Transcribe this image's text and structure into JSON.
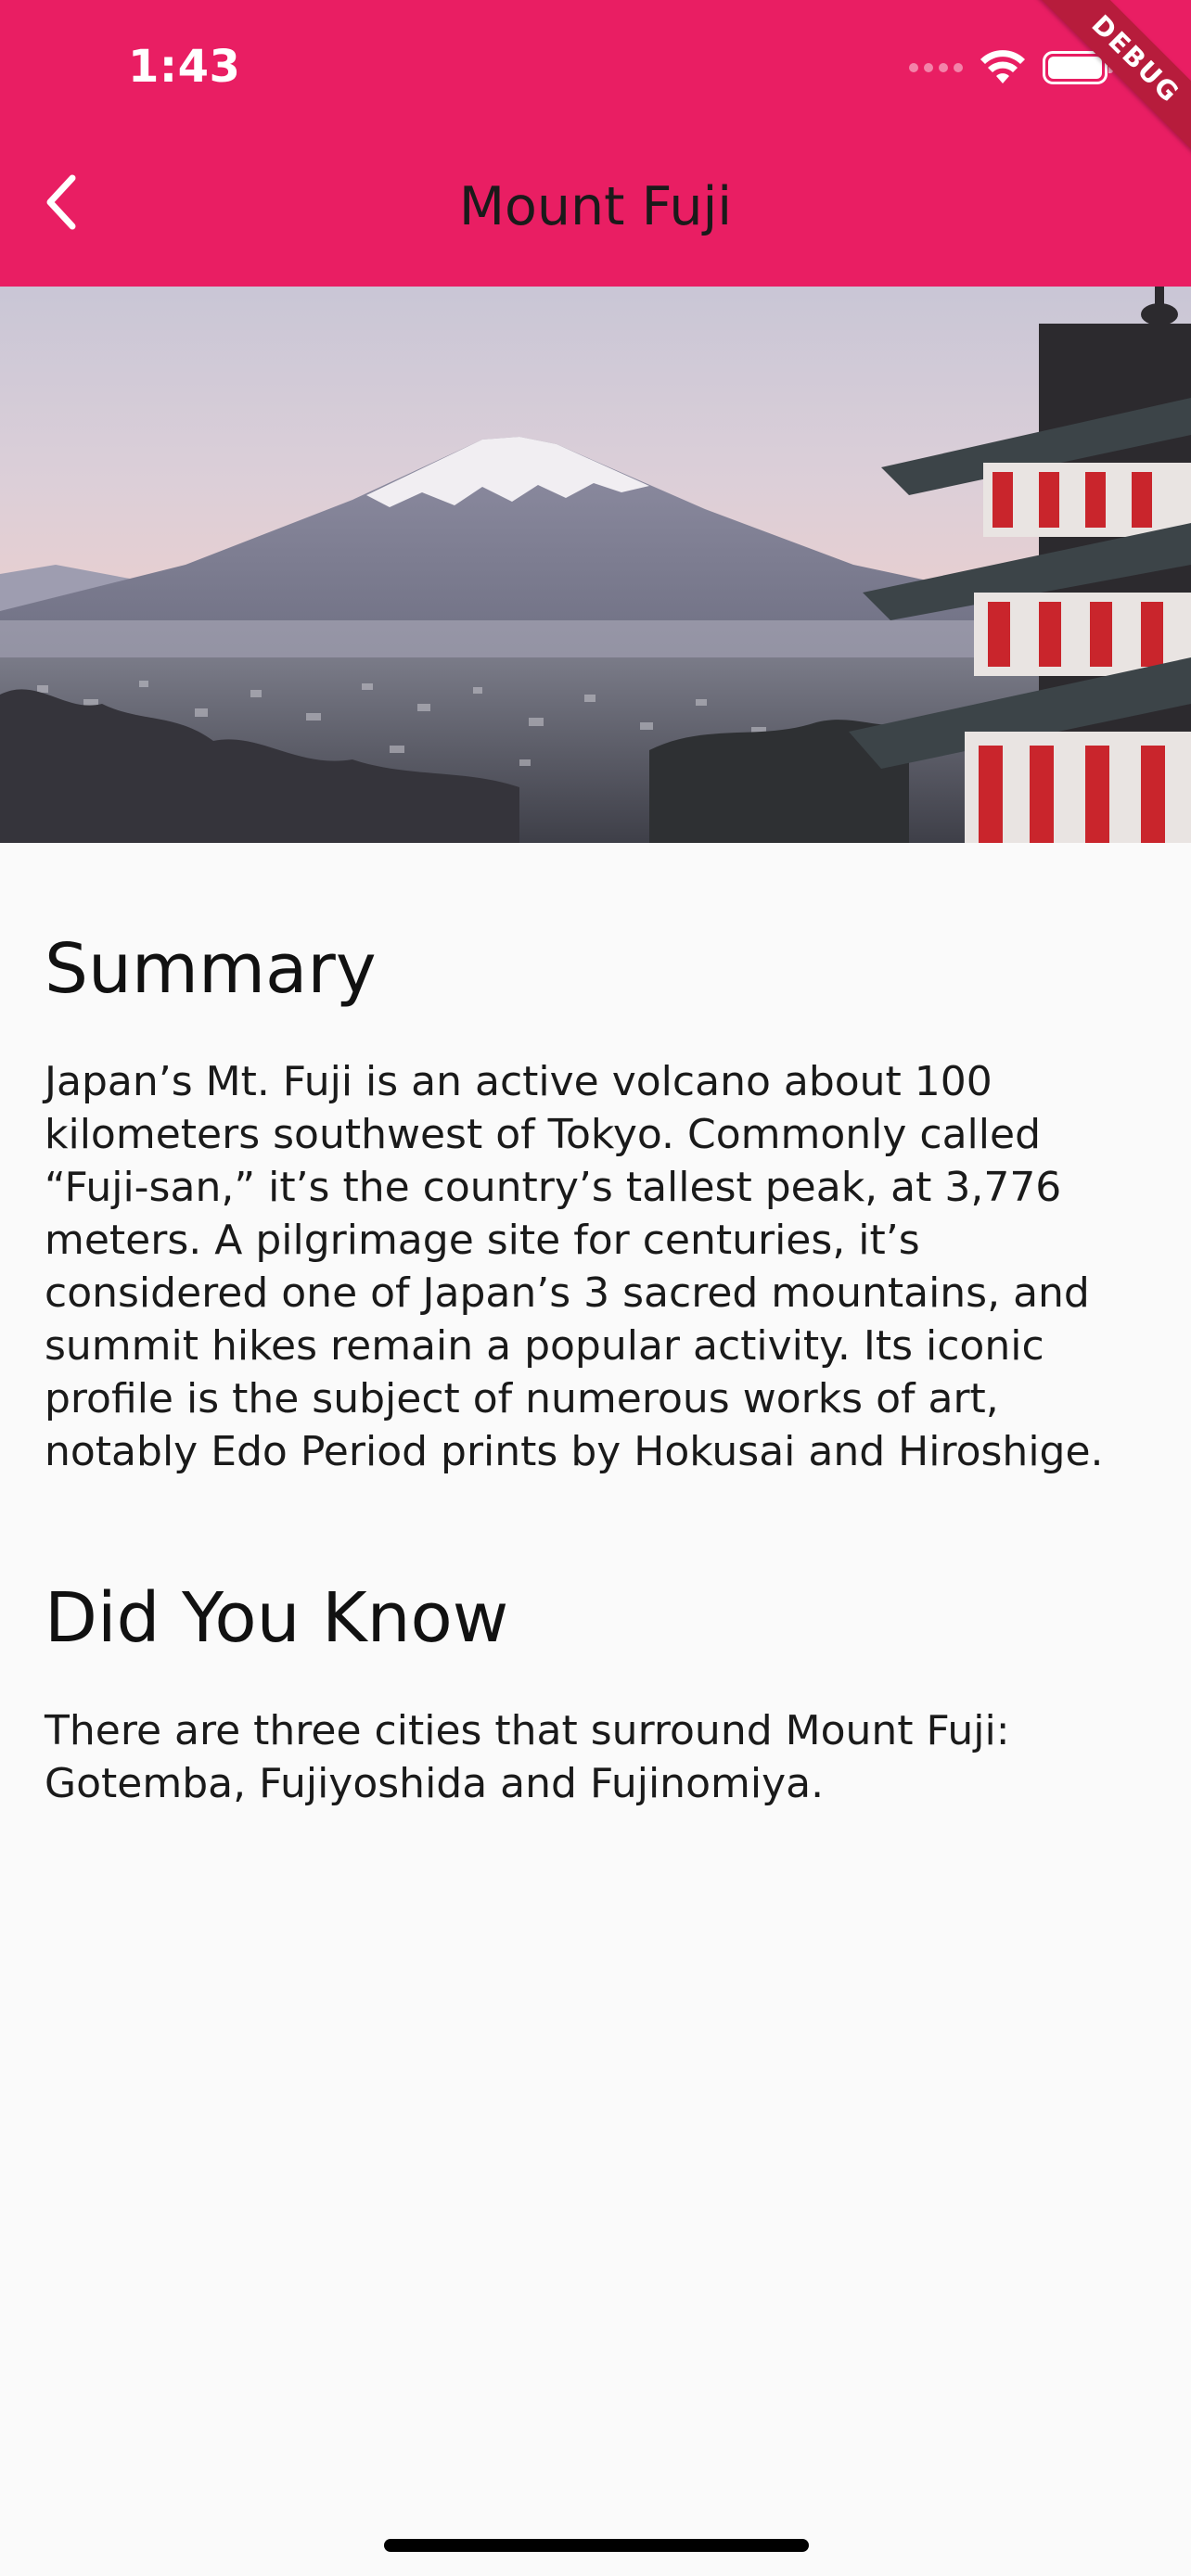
{
  "status_bar": {
    "time": "1:43"
  },
  "app_bar": {
    "title": "Mount Fuji",
    "back_icon": "chevron-left-icon",
    "background_color": "#e91e63"
  },
  "debug_banner": {
    "label": "DEBUG"
  },
  "hero_image": {
    "subject": "mount-fuji-with-pagoda-image"
  },
  "summary": {
    "heading": "Summary",
    "body": "Japan’s Mt. Fuji is an active volcano about 100 kilometers southwest of Tokyo. Commonly called “Fuji-san,” it’s the country’s tallest peak, at 3,776 meters. A pilgrimage site for centuries, it’s considered one of Japan’s 3 sacred mountains, and summit hikes remain a popular activity. Its iconic profile is the subject of numerous works of art, notably Edo Period prints by Hokusai and Hiroshige."
  },
  "did_you_know": {
    "heading": "Did You Know",
    "body": "There are three cities that surround Mount Fuji: Gotemba, Fujiyoshida and Fujinomiya."
  }
}
